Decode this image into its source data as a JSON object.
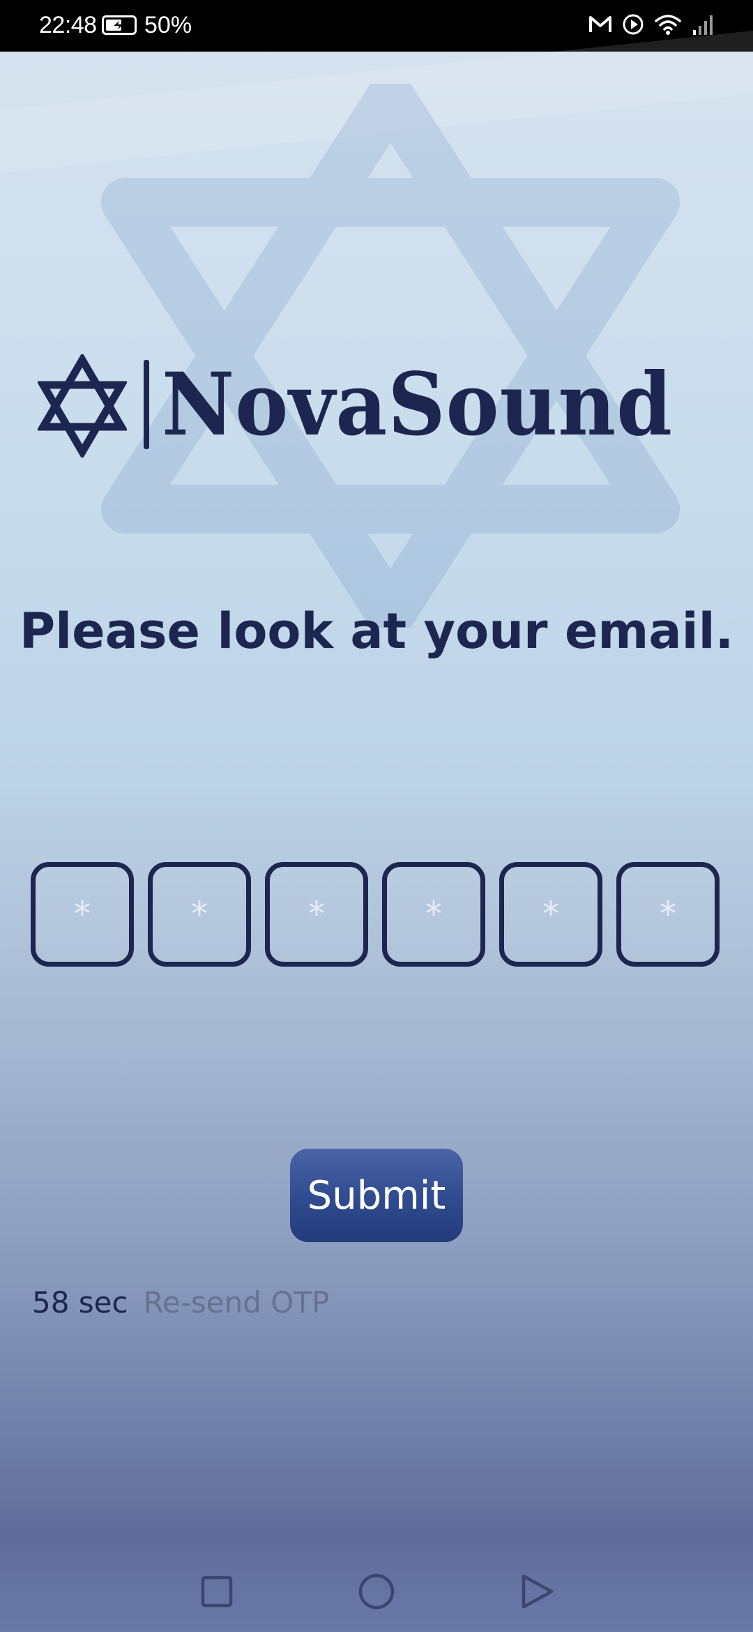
{
  "status_bar": {
    "time": "22:48",
    "battery_percent": "50%",
    "battery_level": 0.5,
    "icons": [
      "gmail-icon",
      "play-icon",
      "wifi-icon",
      "signal-icon"
    ]
  },
  "app": {
    "name": "NovaSound",
    "logo_icon": "star-of-david-icon",
    "brand_color": "#1c2650"
  },
  "headline": "Please look at your email.",
  "otp": {
    "length": 6,
    "placeholder": "*",
    "values": [
      "",
      "",
      "",
      "",
      "",
      ""
    ]
  },
  "submit_label": "Submit",
  "resend": {
    "countdown": "58 sec",
    "link_label": "Re-send OTP"
  },
  "nav_bar": {
    "buttons": [
      "recents-square-icon",
      "home-circle-icon",
      "back-triangle-icon"
    ]
  },
  "colors": {
    "primary": "#1c2650",
    "button": "#2f4a8e",
    "muted": "#66728f"
  }
}
